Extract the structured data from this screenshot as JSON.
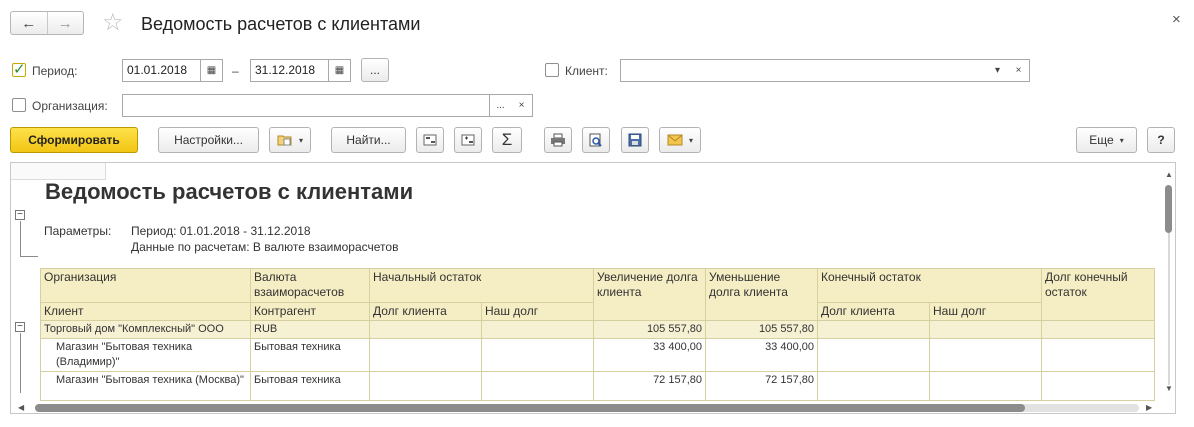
{
  "window": {
    "title": "Ведомость расчетов с клиентами",
    "back_icon": "←",
    "forward_icon": "→",
    "favorite_icon": "☆",
    "close_icon": "×"
  },
  "filters": {
    "period_label": "Период:",
    "period_checked": true,
    "date_from": "01.01.2018",
    "date_to": "31.12.2018",
    "dash": "–",
    "period_select_label": "...",
    "client_label": "Клиент:",
    "client_checked": false,
    "client_value": "",
    "organization_label": "Организация:",
    "organization_checked": false,
    "organization_value": "",
    "choose_label": "...",
    "clear_icon": "×",
    "dropdown_icon": "▾",
    "calendar_icon": "▦"
  },
  "toolbar": {
    "generate_label": "Сформировать",
    "settings_label": "Настройки...",
    "find_label": "Найти...",
    "sum_icon": "Σ",
    "more_label": "Еще",
    "help_label": "?",
    "caret": "▾"
  },
  "report": {
    "title": "Ведомость расчетов с клиентами",
    "params_label": "Параметры:",
    "param_period": "Период: 01.01.2018 - 31.12.2018",
    "param_data": "Данные по расчетам: В валюте взаиморасчетов",
    "group_toggle": "−",
    "headers": {
      "organization": "Организация",
      "currency": "Валюта взаиморасчетов",
      "opening": "Начальный остаток",
      "increase": "Увеличение долга клиента",
      "decrease": "Уменьшение долга клиента",
      "closing": "Конечный остаток",
      "debt_closing": "Долг конечный остаток",
      "client": "Клиент",
      "counterparty": "Контрагент",
      "client_debt": "Долг клиента",
      "our_debt": "Наш долг",
      "client_debt2": "Долг клиента",
      "our_debt2": "Наш долг"
    },
    "group_row": {
      "name": "Торговый дом \"Комплексный\" ООО",
      "currency": "RUB",
      "increase": "105 557,80",
      "decrease": "105 557,80"
    },
    "rows": [
      {
        "client": "Магазин \"Бытовая техника (Владимир)\"",
        "counterparty": "Бытовая техника",
        "increase": "33 400,00",
        "decrease": "33 400,00"
      },
      {
        "client": "Магазин \"Бытовая техника (Москва)\"",
        "counterparty": "Бытовая техника",
        "increase": "72 157,80",
        "decrease": "72 157,80"
      }
    ]
  }
}
